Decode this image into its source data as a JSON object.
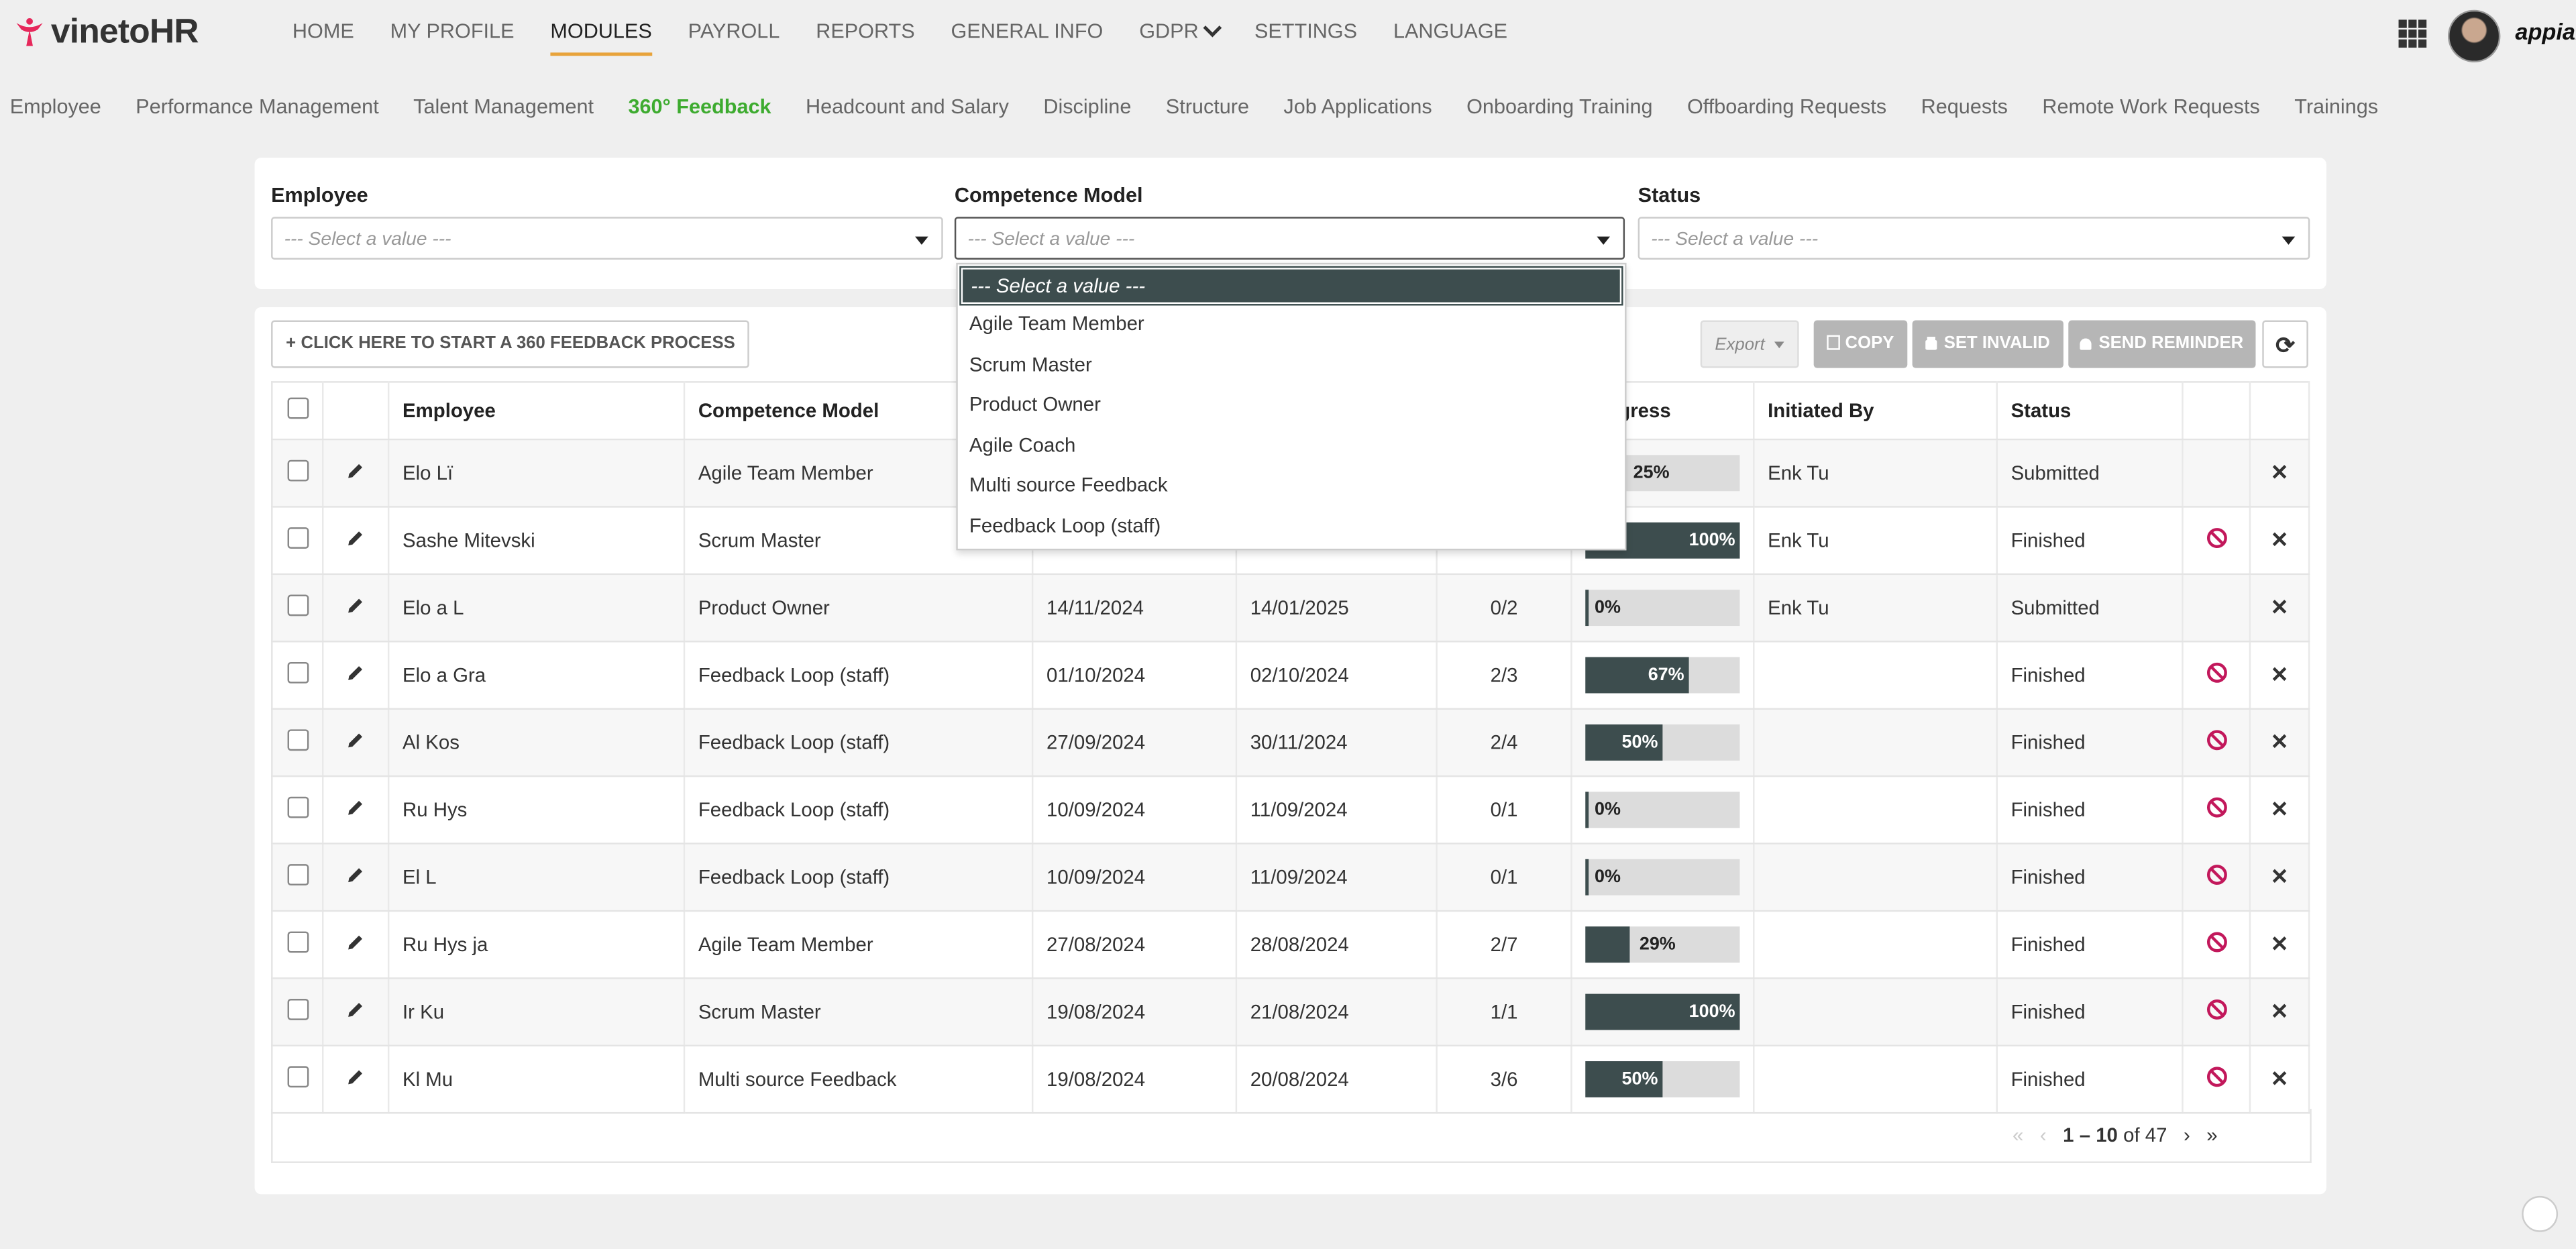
{
  "brand": {
    "name_prefix": "vineto",
    "name_suffix": "HR",
    "accent_color": "#e6285b"
  },
  "main_nav": [
    {
      "label": "HOME"
    },
    {
      "label": "MY PROFILE"
    },
    {
      "label": "MODULES",
      "active": true
    },
    {
      "label": "PAYROLL"
    },
    {
      "label": "REPORTS"
    },
    {
      "label": "GENERAL INFO"
    },
    {
      "label": "GDPR"
    },
    {
      "label": "SETTINGS"
    },
    {
      "label": "LANGUAGE"
    }
  ],
  "account": {
    "platform_label": "appian"
  },
  "sub_nav": [
    {
      "label": "Employee"
    },
    {
      "label": "Performance Management"
    },
    {
      "label": "Talent Management"
    },
    {
      "label": "360° Feedback",
      "active": true
    },
    {
      "label": "Headcount and Salary"
    },
    {
      "label": "Discipline"
    },
    {
      "label": "Structure"
    },
    {
      "label": "Job Applications"
    },
    {
      "label": "Onboarding Training"
    },
    {
      "label": "Offboarding Requests"
    },
    {
      "label": "Requests"
    },
    {
      "label": "Remote Work Requests"
    },
    {
      "label": "Trainings"
    }
  ],
  "filters": {
    "employee": {
      "label": "Employee",
      "placeholder": "--- Select a value ---"
    },
    "competence_model": {
      "label": "Competence Model",
      "placeholder": "--- Select a value ---"
    },
    "status": {
      "label": "Status",
      "placeholder": "--- Select a value ---"
    }
  },
  "dropdown_options": [
    "--- Select a value ---",
    "Agile Team Member",
    "Scrum Master",
    "Product Owner",
    "Agile Coach",
    "Multi source Feedback",
    "Feedback Loop (staff)"
  ],
  "toolbar": {
    "start_label": "CLICK HERE TO START A 360 FEEDBACK PROCESS",
    "export_label": "Export",
    "copy_label": "COPY",
    "set_invalid_label": "SET INVALID",
    "send_reminder_label": "SEND REMINDER"
  },
  "table": {
    "headers": {
      "employee": "Employee",
      "competence_model": "Competence Model",
      "progress": "Progress",
      "initiated_by": "Initiated By",
      "status": "Status"
    },
    "rows": [
      {
        "employee": "Elo  Lï",
        "model": "Agile Team Member",
        "start": "",
        "end": "",
        "count": "",
        "progress": 25,
        "progress_label": "25%",
        "initiated_by": "Enk      Tu",
        "status": "Submitted",
        "invalid_icon": false
      },
      {
        "employee": "Sashe Mitevski",
        "model": "Scrum Master",
        "start": "",
        "end": "",
        "count": "",
        "progress": 100,
        "progress_label": "100%",
        "initiated_by": "Enk      Tu",
        "status": "Finished",
        "invalid_icon": true
      },
      {
        "employee": "Elo   a L",
        "model": "Product Owner",
        "start": "14/11/2024",
        "end": "14/01/2025",
        "count": "0/2",
        "progress": 0,
        "progress_label": "0%",
        "initiated_by": "Enk      Tu",
        "status": "Submitted",
        "invalid_icon": false
      },
      {
        "employee": "Elo   a Gra",
        "model": "Feedback Loop (staff)",
        "start": "01/10/2024",
        "end": "02/10/2024",
        "count": "2/3",
        "progress": 67,
        "progress_label": "67%",
        "initiated_by": "",
        "status": "Finished",
        "invalid_icon": true
      },
      {
        "employee": "Al   Kos",
        "model": "Feedback Loop (staff)",
        "start": "27/09/2024",
        "end": "30/11/2024",
        "count": "2/4",
        "progress": 50,
        "progress_label": "50%",
        "initiated_by": "",
        "status": "Finished",
        "invalid_icon": true
      },
      {
        "employee": "Ru    Hys",
        "model": "Feedback Loop (staff)",
        "start": "10/09/2024",
        "end": "11/09/2024",
        "count": "0/1",
        "progress": 0,
        "progress_label": "0%",
        "initiated_by": "",
        "status": "Finished",
        "invalid_icon": true
      },
      {
        "employee": "El    L",
        "model": "Feedback Loop (staff)",
        "start": "10/09/2024",
        "end": "11/09/2024",
        "count": "0/1",
        "progress": 0,
        "progress_label": "0%",
        "initiated_by": "",
        "status": "Finished",
        "invalid_icon": true
      },
      {
        "employee": "Ru    Hys       ja",
        "model": "Agile Team Member",
        "start": "27/08/2024",
        "end": "28/08/2024",
        "count": "2/7",
        "progress": 29,
        "progress_label": "29%",
        "initiated_by": "",
        "status": "Finished",
        "invalid_icon": true
      },
      {
        "employee": "Ir   Ku",
        "model": "Scrum Master",
        "start": "19/08/2024",
        "end": "21/08/2024",
        "count": "1/1",
        "progress": 100,
        "progress_label": "100%",
        "initiated_by": "",
        "status": "Finished",
        "invalid_icon": true
      },
      {
        "employee": "Kl     Mu",
        "model": "Multi source Feedback",
        "start": "19/08/2024",
        "end": "20/08/2024",
        "count": "3/6",
        "progress": 50,
        "progress_label": "50%",
        "initiated_by": "",
        "status": "Finished",
        "invalid_icon": true
      }
    ]
  },
  "pagination": {
    "range": "1 – 10",
    "of_label": "of 47"
  },
  "colors": {
    "bar_fill": "#3d4d4e",
    "bar_track": "#dcdcdc",
    "invalid_icon": "#c2185b",
    "active_subnav": "#3dab2f",
    "active_underline": "#e8a33a"
  }
}
